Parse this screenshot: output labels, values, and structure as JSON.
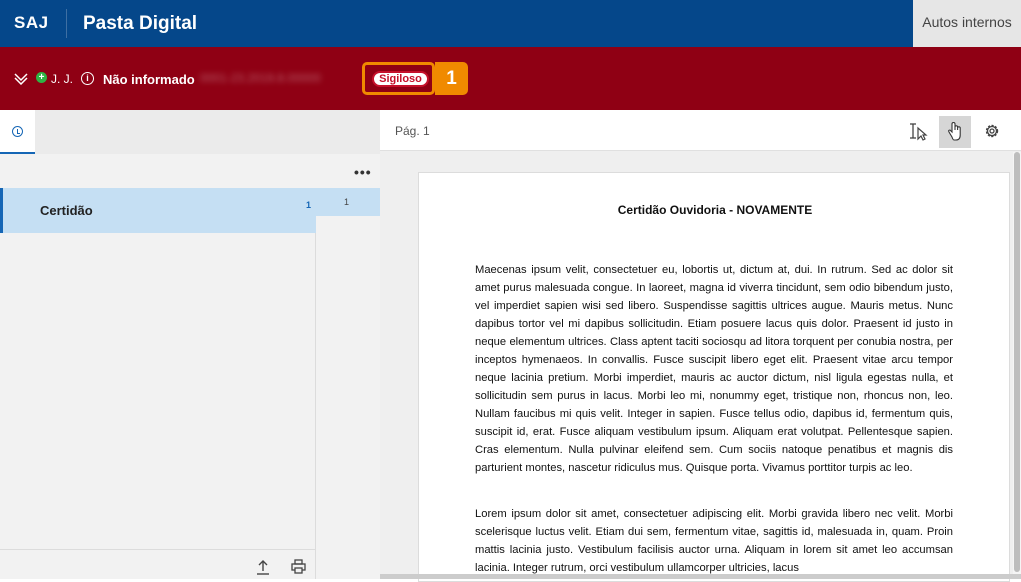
{
  "header": {
    "brand": "SAJ",
    "title": "Pasta Digital",
    "tab_autos": "Autos internos"
  },
  "process_bar": {
    "party": "J. J.",
    "party_status": "Não informado",
    "process_number_blurred": "0001-23.2019.8.00000",
    "badge_label": "Sigiloso",
    "step_number": "1",
    "colors": {
      "bar": "#8f0014",
      "highlight": "#f08a00",
      "badge": "#c4102a"
    }
  },
  "left_panel": {
    "more_label": "•••",
    "documents": [
      {
        "name": "Certidão",
        "count": "1"
      }
    ],
    "pages": [
      {
        "number": "1"
      }
    ]
  },
  "viewer": {
    "page_label": "Pág. 1",
    "doc_title": "Certidão Ouvidoria - NOVAMENTE",
    "paragraphs": [
      "Maecenas ipsum velit, consectetuer eu, lobortis ut, dictum at, dui. In rutrum. Sed ac dolor sit amet purus malesuada congue. In laoreet, magna id viverra tincidunt, sem odio bibendum justo, vel imperdiet sapien wisi sed libero. Suspendisse sagittis ultrices augue. Mauris metus. Nunc dapibus tortor vel mi dapibus sollicitudin. Etiam posuere lacus quis dolor. Praesent id justo in neque elementum ultrices. Class aptent taciti sociosqu ad litora torquent per conubia nostra, per inceptos hymenaeos. In convallis. Fusce suscipit libero eget elit. Praesent vitae arcu tempor neque lacinia pretium. Morbi imperdiet, mauris ac auctor dictum, nisl ligula egestas nulla, et sollicitudin sem purus in lacus. Morbi leo mi, nonummy eget, tristique non, rhoncus non, leo. Nullam faucibus mi quis velit. Integer in sapien. Fusce tellus odio, dapibus id, fermentum quis, suscipit id, erat. Fusce aliquam vestibulum ipsum. Aliquam erat volutpat. Pellentesque sapien. Cras elementum. Nulla pulvinar eleifend sem. Cum sociis natoque penatibus et magnis dis parturient montes, nascetur ridiculus mus. Quisque porta. Vivamus porttitor turpis ac leo.",
      "Lorem ipsum dolor sit amet, consectetuer adipiscing elit. Morbi gravida libero nec velit. Morbi scelerisque luctus velit. Etiam dui sem, fermentum vitae, sagittis id, malesuada in, quam. Proin mattis lacinia justo. Vestibulum facilisis auctor urna. Aliquam in lorem sit amet leo accumsan lacinia. Integer rutrum, orci vestibulum ullamcorper ultricies, lacus"
    ]
  }
}
